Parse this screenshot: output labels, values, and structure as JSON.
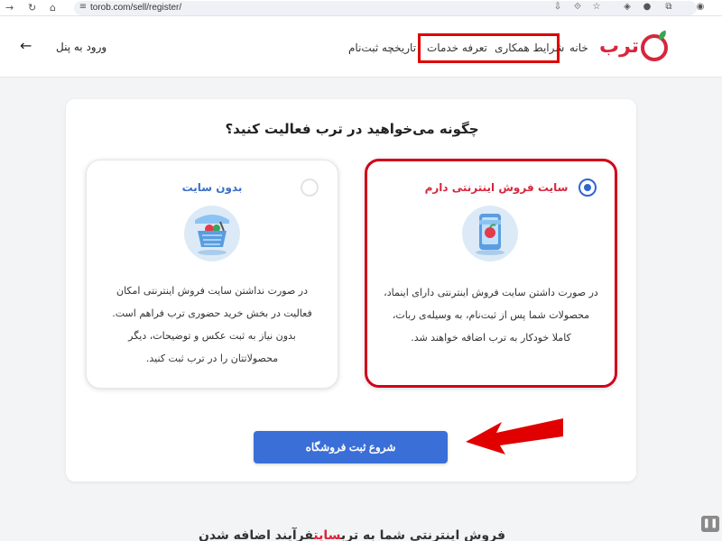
{
  "browser": {
    "url": "torob.com/sell/register/"
  },
  "header": {
    "logo_text": "ترب",
    "nav": {
      "home": "خانه",
      "cooperation": "شرایط همکاری",
      "pricing": "تعرفه خدمات",
      "history": "تاریخچه ثبت‌نام"
    },
    "login": "ورود به پنل"
  },
  "main": {
    "question": "چگونه می‌خواهید در ترب فعالیت کنید؟",
    "options": [
      {
        "title": "سایت فروش اینترنتی دارم",
        "selected": true,
        "lines": [
          "در صورت داشتن سایت فروش اینترنتی دارای اینماد،",
          "محصولات شما پس از ثبت‌نام، به وسیله‌ی ربات،",
          "کاملا خودکار به ترب اضافه خواهند شد."
        ]
      },
      {
        "title": "بدون سایت",
        "selected": false,
        "lines": [
          "در صورت نداشتن سایت فروش اینترنتی امکان",
          "فعالیت در بخش خرید حضوری ترب فراهم است.",
          "بدون نیاز به ثبت عکس و توضیحات، دیگر",
          "محصولاتتان را در ترب ثبت کنید."
        ]
      }
    ],
    "start_button": "شروع ثبت فروشگاه"
  },
  "footer_heading": {
    "before": "فرآیند اضافه شدن ",
    "highlight": "سایت",
    "after": " فروش اینترنتی شما به ترب"
  },
  "colors": {
    "brand_red": "#d7263d",
    "primary_blue": "#3a6fd8",
    "annotation_red": "#e00000"
  }
}
